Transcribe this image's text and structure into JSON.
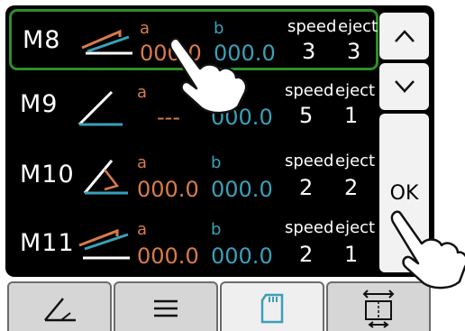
{
  "rows": [
    {
      "id": "M8",
      "a_label": "a",
      "a_value": "000.0",
      "b_label": "b",
      "b_value": "000.0",
      "speed_label": "speed",
      "speed_value": "3",
      "eject_label": "eject",
      "eject_value": "3"
    },
    {
      "id": "M9",
      "a_label": "a",
      "a_value": "---",
      "b_label": "b",
      "b_value": "000.0",
      "speed_label": "speed",
      "speed_value": "5",
      "eject_label": "eject",
      "eject_value": "1"
    },
    {
      "id": "M10",
      "a_label": "a",
      "a_value": "000.0",
      "b_label": "b",
      "b_value": "000.0",
      "speed_label": "speed",
      "speed_value": "2",
      "eject_label": "eject",
      "eject_value": "2"
    },
    {
      "id": "M11",
      "a_label": "a",
      "a_value": "000.0",
      "b_label": "b",
      "b_value": "000.0",
      "speed_label": "speed",
      "speed_value": "2",
      "eject_label": "eject",
      "eject_value": "1"
    }
  ],
  "side": {
    "ok_label": "OK",
    "up_icon": "chevron-up-icon",
    "down_icon": "chevron-down-icon"
  },
  "tabs": [
    {
      "icon": "angle-icon"
    },
    {
      "icon": "list-icon"
    },
    {
      "icon": "sd-card-icon",
      "active": true
    },
    {
      "icon": "resize-icon"
    }
  ],
  "colors": {
    "a": "#d97b4a",
    "b": "#3aa0b8",
    "selected_border": "#2c8f2c"
  }
}
